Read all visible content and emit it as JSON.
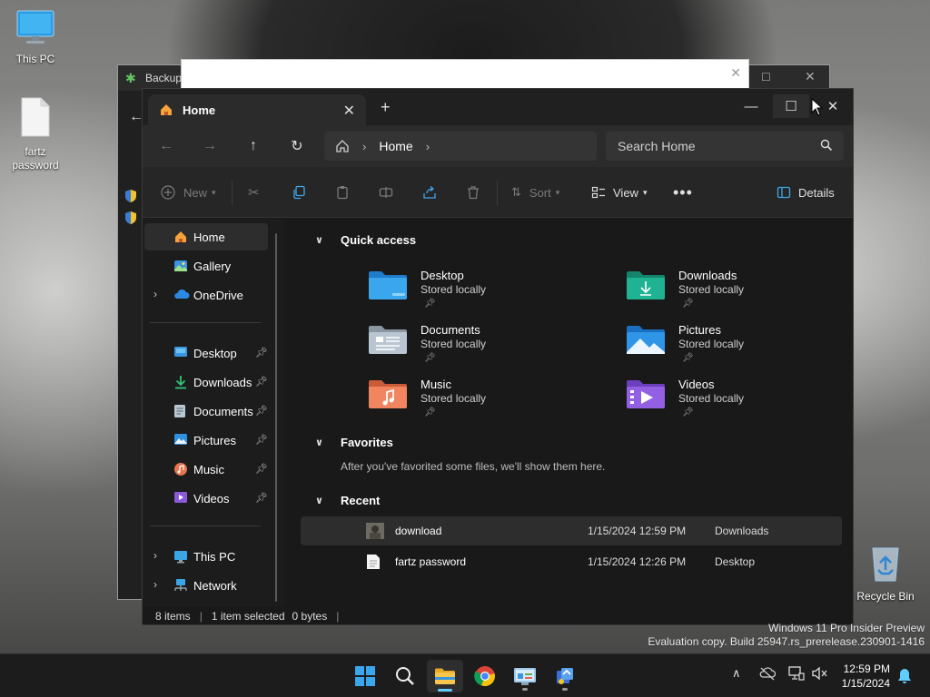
{
  "desktop": {
    "icons": [
      {
        "label": "This PC"
      },
      {
        "label": "fartz password"
      },
      {
        "label": "Recycle Bin"
      }
    ]
  },
  "background_window": {
    "title": "Backup"
  },
  "explorer": {
    "tab": {
      "label": "Home"
    },
    "address": {
      "crumb": "Home"
    },
    "search": {
      "placeholder": "Search Home"
    },
    "toolbar": {
      "new_label": "New",
      "sort_label": "Sort",
      "view_label": "View",
      "details_label": "Details"
    },
    "sidebar": {
      "items": [
        {
          "label": "Home"
        },
        {
          "label": "Gallery"
        },
        {
          "label": "OneDrive"
        },
        {
          "label": "Desktop"
        },
        {
          "label": "Downloads"
        },
        {
          "label": "Documents"
        },
        {
          "label": "Pictures"
        },
        {
          "label": "Music"
        },
        {
          "label": "Videos"
        },
        {
          "label": "This PC"
        },
        {
          "label": "Network"
        }
      ]
    },
    "quick_access": {
      "heading": "Quick access",
      "items": [
        {
          "name": "Desktop",
          "status": "Stored locally"
        },
        {
          "name": "Downloads",
          "status": "Stored locally"
        },
        {
          "name": "Documents",
          "status": "Stored locally"
        },
        {
          "name": "Pictures",
          "status": "Stored locally"
        },
        {
          "name": "Music",
          "status": "Stored locally"
        },
        {
          "name": "Videos",
          "status": "Stored locally"
        }
      ]
    },
    "favorites": {
      "heading": "Favorites",
      "empty_message": "After you've favorited some files, we'll show them here."
    },
    "recent": {
      "heading": "Recent",
      "rows": [
        {
          "name": "download",
          "date": "1/15/2024 12:59 PM",
          "location": "Downloads"
        },
        {
          "name": "fartz password",
          "date": "1/15/2024 12:26 PM",
          "location": "Desktop"
        }
      ]
    },
    "status": {
      "items": "8 items",
      "selected": "1 item selected",
      "size": "0 bytes"
    }
  },
  "watermark": {
    "line1": "Windows 11 Pro Insider Preview",
    "line2": "Evaluation copy. Build 25947.rs_prerelease.230901-1416"
  },
  "taskbar": {
    "time": "12:59 PM",
    "date": "1/15/2024"
  },
  "colors": {
    "accent": "#60cdff",
    "folder_blue": "#3a96dd",
    "folder_green": "#1aa386"
  }
}
